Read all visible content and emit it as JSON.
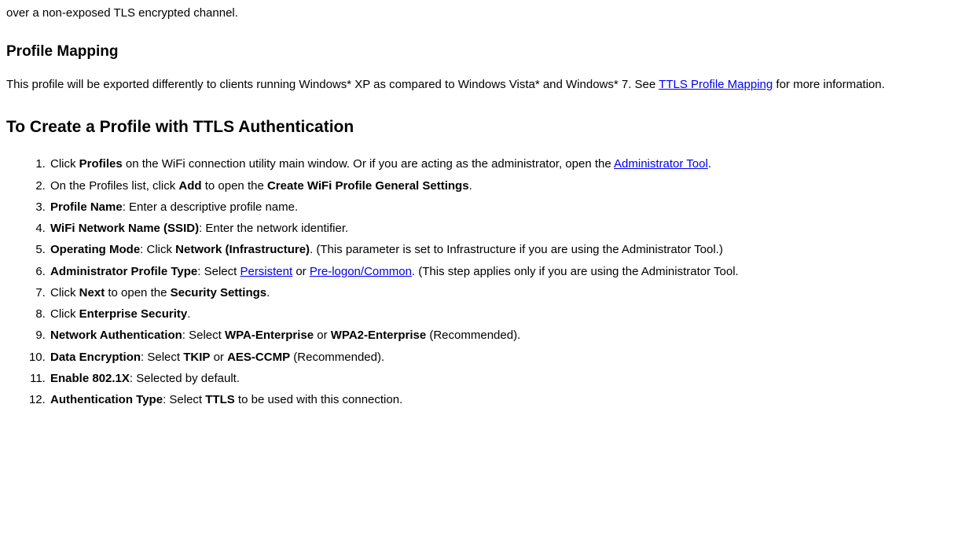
{
  "lead_fragment": "over a non-exposed TLS encrypted channel.",
  "section1": {
    "heading": "Profile Mapping",
    "para_pre": "This profile will be exported differently to clients running Windows* XP as compared to Windows Vista* and Windows* 7. See ",
    "link": "TTLS Profile Mapping",
    "para_post": " for more information."
  },
  "section2": {
    "heading": "To Create a Profile with TTLS Authentication"
  },
  "steps": {
    "s1_a": "Click ",
    "s1_b": "Profiles",
    "s1_c": " on the WiFi connection utility main window. Or if you are acting as the administrator, open the ",
    "s1_link": "Administrator Tool",
    "s1_d": ".",
    "s2_a": "On the Profiles list, click ",
    "s2_b": "Add",
    "s2_c": " to open the ",
    "s2_d": "Create WiFi Profile General Settings",
    "s2_e": ".",
    "s3_a": "Profile Name",
    "s3_b": ": Enter a descriptive profile name.",
    "s4_a": "WiFi Network Name (SSID)",
    "s4_b": ": Enter the network identifier.",
    "s5_a": "Operating Mode",
    "s5_b": ": Click ",
    "s5_c": "Network (Infrastructure)",
    "s5_d": ". (This parameter is set to Infrastructure if you are using the Administrator Tool.)",
    "s6_a": "Administrator Profile Type",
    "s6_b": ": Select ",
    "s6_link1": "Persistent",
    "s6_c": " or ",
    "s6_link2": "Pre-logon/Common",
    "s6_d": ". (This step applies only if you are using the Administrator Tool.",
    "s7_a": "Click ",
    "s7_b": "Next",
    "s7_c": " to open the ",
    "s7_d": "Security Settings",
    "s7_e": ".",
    "s8_a": "Click ",
    "s8_b": "Enterprise Security",
    "s8_c": ".",
    "s9_a": "Network Authentication",
    "s9_b": ": Select ",
    "s9_c": "WPA-Enterprise",
    "s9_d": " or ",
    "s9_e": "WPA2-Enterprise",
    "s9_f": " (Recommended).",
    "s10_a": "Data Encryption",
    "s10_b": ": Select ",
    "s10_c": "TKIP",
    "s10_d": " or ",
    "s10_e": "AES-CCMP",
    "s10_f": " (Recommended).",
    "s11_a": "Enable 802.1X",
    "s11_b": ": Selected by default.",
    "s12_a": "Authentication Type",
    "s12_b": ": Select ",
    "s12_c": "TTLS",
    "s12_d": " to be used with this connection."
  }
}
